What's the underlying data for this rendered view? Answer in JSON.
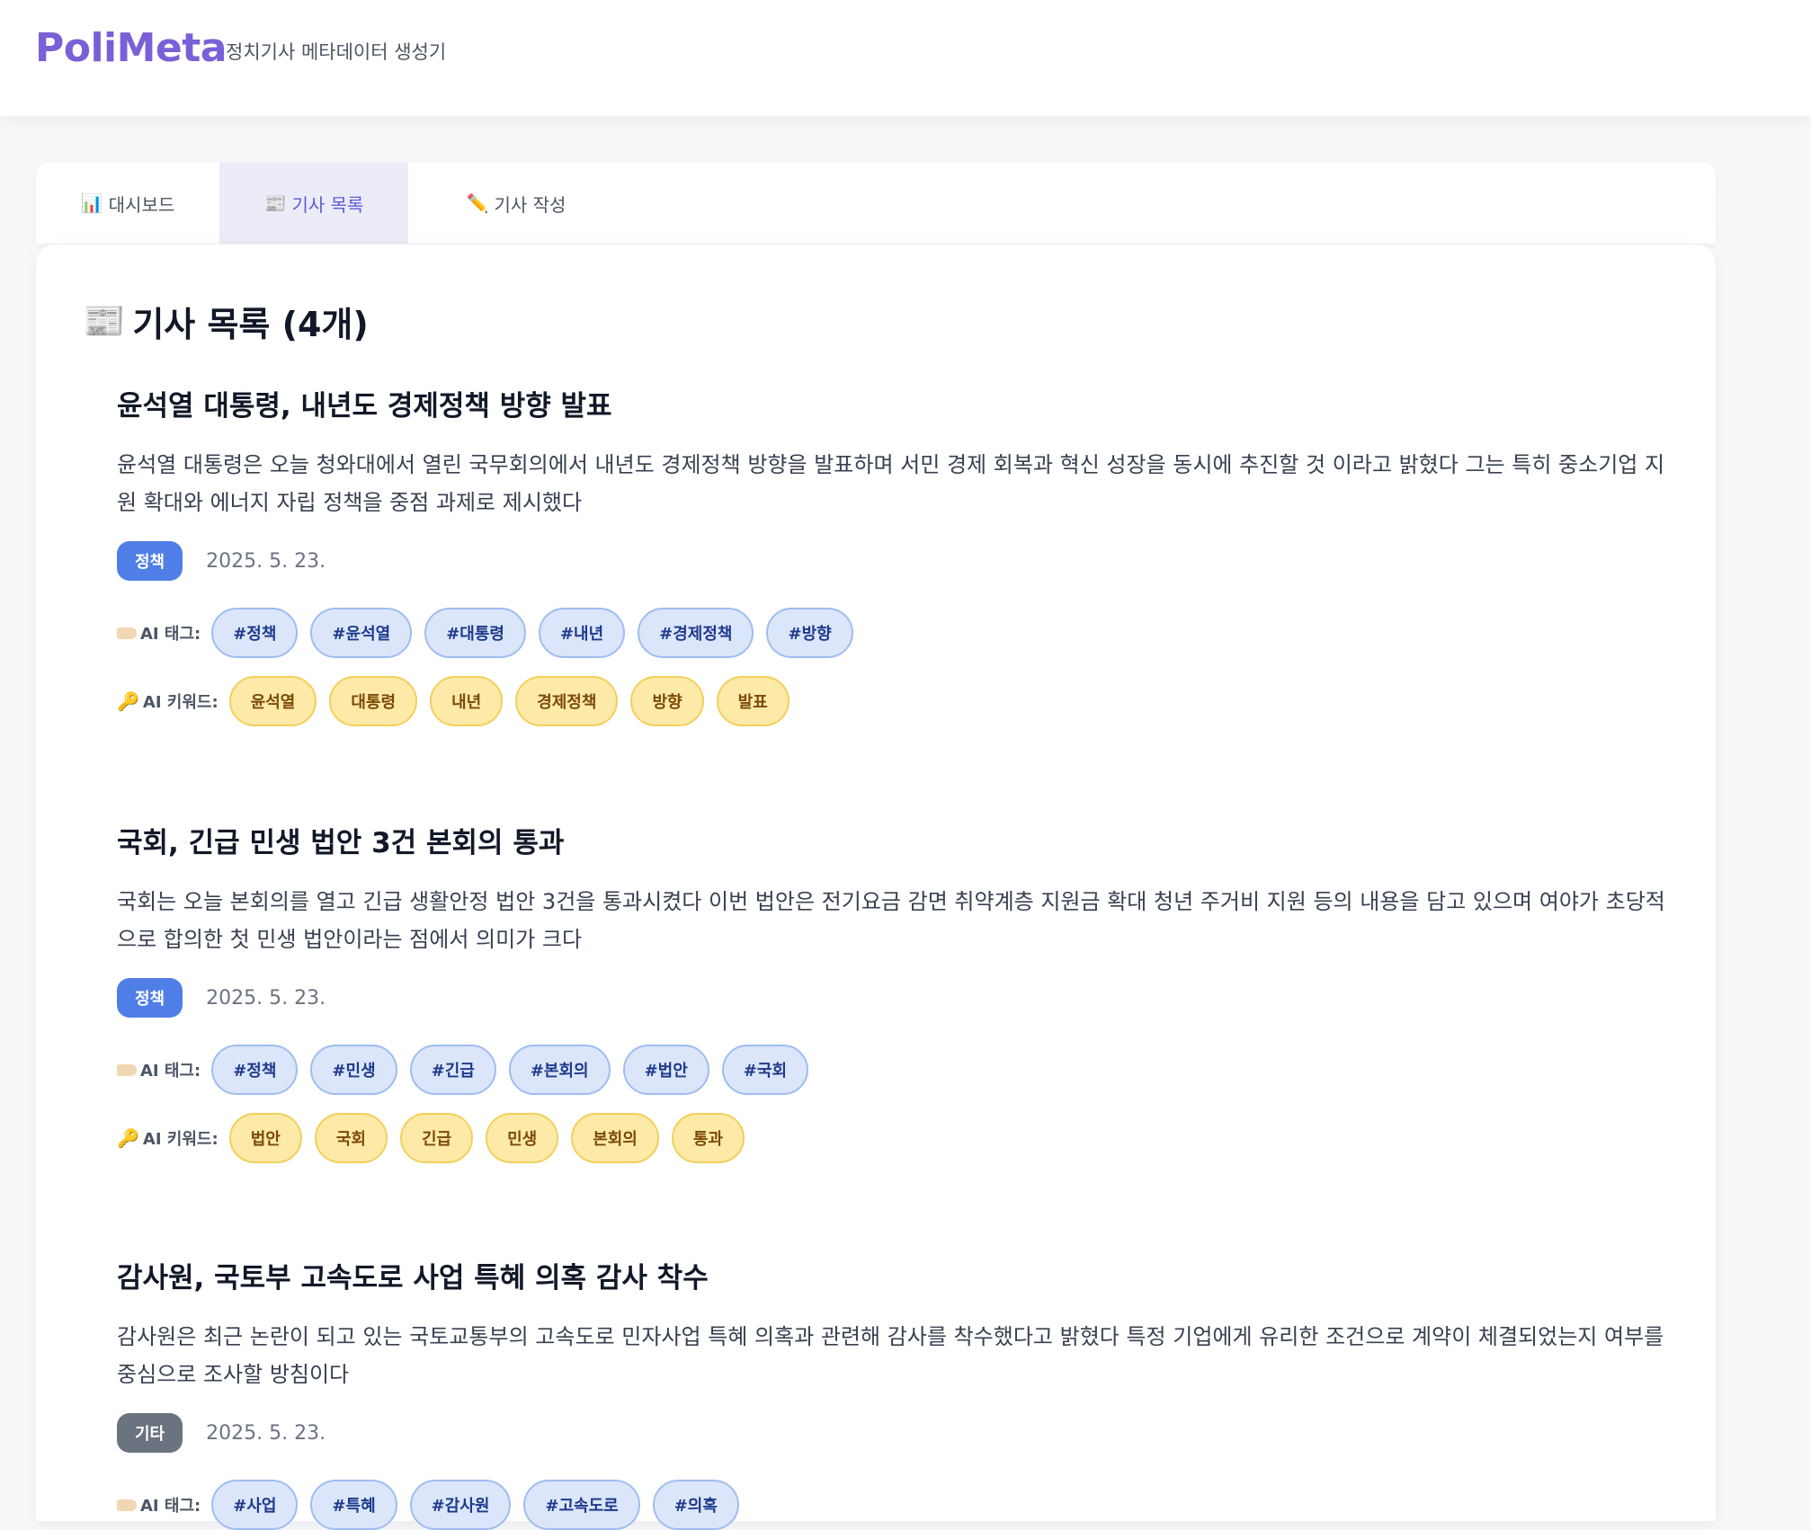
{
  "app": {
    "logo": "PoliMeta",
    "subtitle": "정치기사 메타데이터 생성기"
  },
  "tabs": [
    {
      "icon": "📊",
      "label": "대시보드",
      "active": false
    },
    {
      "icon": "📰",
      "label": "기사 목록",
      "active": true
    },
    {
      "icon": "✏️",
      "label": "기사 작성",
      "active": false
    }
  ],
  "list": {
    "icon": "📰",
    "title": "기사 목록 (4개)"
  },
  "labels": {
    "ai_tags": "AI 태그:",
    "ai_keywords": "AI 키워드:"
  },
  "articles": [
    {
      "title": "윤석열 대통령, 내년도 경제정책 방향 발표",
      "body": "윤석열 대통령은 오늘 청와대에서 열린 국무회의에서 내년도 경제정책 방향을 발표하며 서민 경제 회복과 혁신 성장을 동시에 추진할 것 이라고 밝혔다 그는 특히 중소기업 지원 확대와 에너지 자립 정책을 중점 과제로 제시했다",
      "category": "정책",
      "date": "2025. 5. 23.",
      "tags": [
        "#정책",
        "#윤석열",
        "#대통령",
        "#내년",
        "#경제정책",
        "#방향"
      ],
      "keywords": [
        "윤석열",
        "대통령",
        "내년",
        "경제정책",
        "방향",
        "발표"
      ]
    },
    {
      "title": "국회, 긴급 민생 법안 3건 본회의 통과",
      "body": "국회는 오늘 본회의를 열고 긴급 생활안정 법안 3건을 통과시켰다 이번 법안은 전기요금 감면 취약계층 지원금 확대 청년 주거비 지원 등의 내용을 담고 있으며 여야가 초당적으로 합의한 첫 민생 법안이라는 점에서 의미가 크다",
      "category": "정책",
      "date": "2025. 5. 23.",
      "tags": [
        "#정책",
        "#민생",
        "#긴급",
        "#본회의",
        "#법안",
        "#국회"
      ],
      "keywords": [
        "법안",
        "국회",
        "긴급",
        "민생",
        "본회의",
        "통과"
      ]
    },
    {
      "title": "감사원, 국토부 고속도로 사업 특혜 의혹 감사 착수",
      "body": "감사원은 최근 논란이 되고 있는 국토교통부의 고속도로 민자사업 특혜 의혹과 관련해 감사를 착수했다고 밝혔다 특정 기업에게 유리한 조건으로 계약이 체결되었는지 여부를 중심으로 조사할 방침이다",
      "category": "기타",
      "date": "2025. 5. 23.",
      "tags": [
        "#사업",
        "#특혜",
        "#감사원",
        "#고속도로",
        "#의혹"
      ],
      "keywords": []
    }
  ]
}
